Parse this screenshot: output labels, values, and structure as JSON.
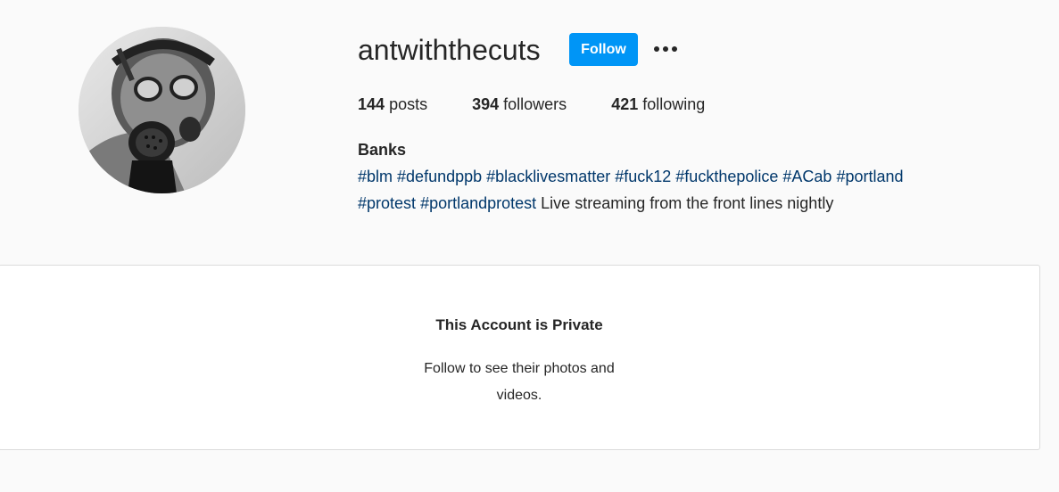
{
  "profile": {
    "username": "antwiththecuts",
    "follow_label": "Follow",
    "more_icon": "more-options-icon",
    "avatar_alt": "profile-picture",
    "stats": {
      "posts_count": "144",
      "posts_label": "posts",
      "followers_count": "394",
      "followers_label": "followers",
      "following_count": "421",
      "following_label": "following"
    },
    "bio": {
      "name": "Banks",
      "hashtags": [
        "#blm",
        "#defundppb",
        "#blacklivesmatter",
        "#fuck12",
        "#fuckthepolice",
        "#ACab",
        "#portland",
        "#protest",
        "#portlandprotest"
      ],
      "text": "Live streaming from the front lines nightly"
    }
  },
  "private_notice": {
    "title": "This Account is Private",
    "subtitle": "Follow to see their photos and videos."
  },
  "colors": {
    "accent": "#0095f6",
    "hashtag": "#00376b",
    "background": "#fafafa",
    "card": "#ffffff",
    "border": "#dbdbdb"
  }
}
